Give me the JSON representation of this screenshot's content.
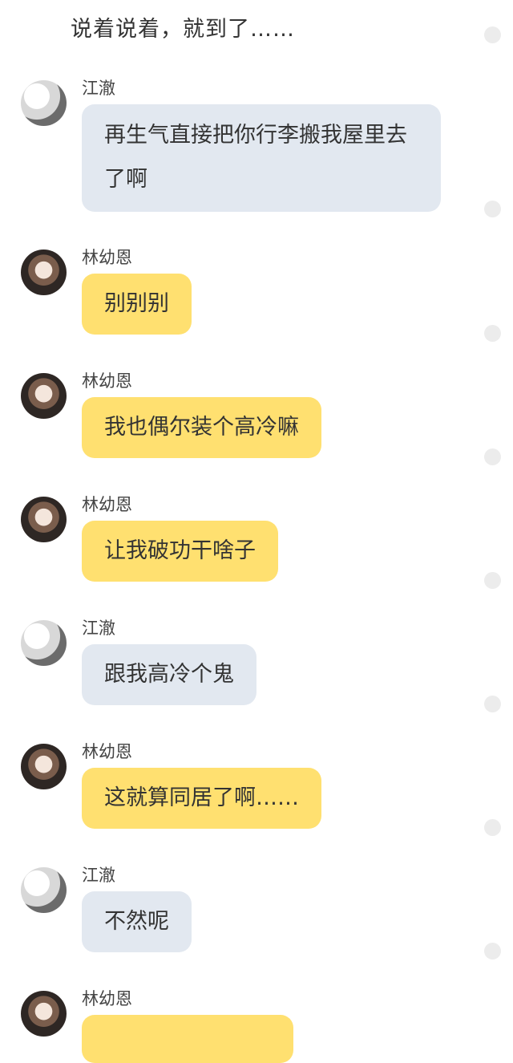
{
  "narration": "说着说着，就到了……",
  "messages": [
    {
      "sender": "江澈",
      "text": "再生气直接把你行李搬我屋里去了啊",
      "side": "male"
    },
    {
      "sender": "林幼恩",
      "text": "别别别",
      "side": "female"
    },
    {
      "sender": "林幼恩",
      "text": "我也偶尔装个高冷嘛",
      "side": "female"
    },
    {
      "sender": "林幼恩",
      "text": "让我破功干啥子",
      "side": "female"
    },
    {
      "sender": "江澈",
      "text": "跟我高冷个鬼",
      "side": "male"
    },
    {
      "sender": "林幼恩",
      "text": "这就算同居了啊……",
      "side": "female"
    },
    {
      "sender": "江澈",
      "text": "不然呢",
      "side": "male"
    },
    {
      "sender": "林幼恩",
      "text": "",
      "side": "female"
    }
  ],
  "colors": {
    "male_bubble": "#e2e8f0",
    "female_bubble": "#ffe070",
    "background": "#ffffff"
  }
}
